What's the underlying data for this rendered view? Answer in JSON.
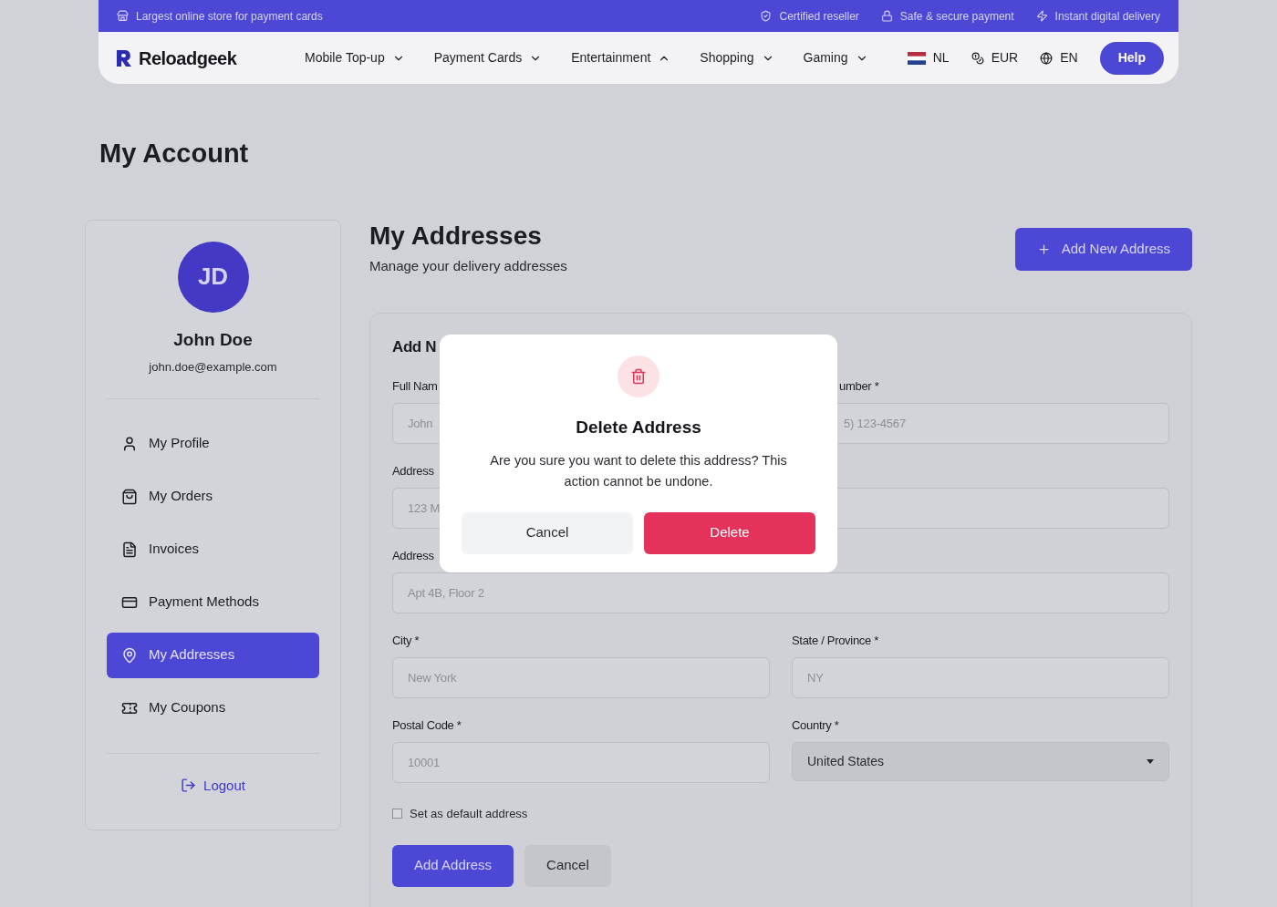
{
  "topbar": {
    "left": "Largest online store for payment cards",
    "badges": [
      {
        "kind": "shield",
        "text": "Certified reseller"
      },
      {
        "kind": "lock",
        "text": "Safe & secure payment"
      },
      {
        "kind": "bolt",
        "text": "Instant digital delivery"
      }
    ]
  },
  "header": {
    "logo": "Reloadgeek",
    "nav": [
      {
        "label": "Mobile Top-up",
        "expanded": false
      },
      {
        "label": "Payment Cards",
        "expanded": false
      },
      {
        "label": "Entertainment",
        "expanded": true
      },
      {
        "label": "Shopping",
        "expanded": false
      },
      {
        "label": "Gaming",
        "expanded": false
      }
    ],
    "locale": [
      {
        "kind": "flag",
        "text": "NL"
      },
      {
        "kind": "coins",
        "text": "EUR"
      },
      {
        "kind": "globe",
        "text": "EN"
      }
    ],
    "help": "Help"
  },
  "page_title": "My Account",
  "profile": {
    "initials": "JD",
    "name": "John Doe",
    "email": "john.doe@example.com"
  },
  "menu": [
    {
      "kind": "user",
      "label": "My Profile",
      "selected": false
    },
    {
      "kind": "bag",
      "label": "My Orders",
      "selected": false
    },
    {
      "kind": "invoice",
      "label": "Invoices",
      "selected": false
    },
    {
      "kind": "card",
      "label": "Payment Methods",
      "selected": false
    },
    {
      "kind": "pin",
      "label": "My Addresses",
      "selected": true
    },
    {
      "kind": "coupon",
      "label": "My Coupons",
      "selected": false
    }
  ],
  "logout": "Logout",
  "section": {
    "title": "My Addresses",
    "subtitle": "Manage your delivery addresses",
    "add_button": "Add New Address"
  },
  "form": {
    "title": "Add N",
    "rows": [
      [
        {
          "label": "Full Nam",
          "placeholder": "John"
        },
        {
          "label": "umber *",
          "placeholder": "5) 123-4567",
          "kind": "covered"
        }
      ],
      [
        {
          "label": "Address",
          "placeholder": "123 M"
        },
        {}
      ],
      [
        {
          "label": "Address",
          "placeholder": "Apt 4B, Floor 2",
          "full": true
        }
      ],
      [
        {
          "label": "City *",
          "placeholder": "New York"
        },
        {
          "label": "State / Province *",
          "placeholder": "NY"
        }
      ],
      [
        {
          "label": "Postal Code *",
          "placeholder": "10001"
        },
        {
          "label": "Country *",
          "value": "United States",
          "kind": "select"
        }
      ]
    ],
    "default_checkbox": {
      "label": "Set as default address",
      "checked": false
    },
    "submit": "Add Address",
    "cancel": "Cancel"
  },
  "dialog": {
    "title": "Delete Address",
    "message": "Are you sure you want to delete this address? This action cannot be undone.",
    "cancel": "Cancel",
    "confirm": "Delete"
  }
}
